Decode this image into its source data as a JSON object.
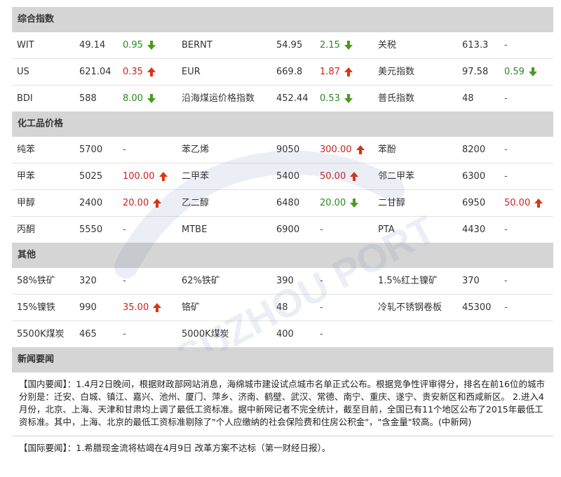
{
  "colors": {
    "up": "#cc2222",
    "down": "#2a8a1e",
    "header_bg": "#d5d5d5"
  },
  "watermark_text": "SUZHOU PORT",
  "sections": [
    {
      "title": "综合指数",
      "rows": [
        [
          {
            "name": "WIT",
            "value": "49.14",
            "change": "0.95",
            "dir": "down"
          },
          {
            "name": "BERNT",
            "value": "54.95",
            "change": "2.15",
            "dir": "down"
          },
          {
            "name": "关税",
            "value": "613.3",
            "change": "-",
            "dir": "flat"
          }
        ],
        [
          {
            "name": "US",
            "value": "621.04",
            "change": "0.35",
            "dir": "up"
          },
          {
            "name": "EUR",
            "value": "669.8",
            "change": "1.87",
            "dir": "up"
          },
          {
            "name": "美元指数",
            "value": "97.58",
            "change": "0.59",
            "dir": "down"
          }
        ],
        [
          {
            "name": "BDI",
            "value": "588",
            "change": "8.00",
            "dir": "down"
          },
          {
            "name": "沿海煤运价格指数",
            "value": "452.44",
            "change": "0.53",
            "dir": "down"
          },
          {
            "name": "普氏指数",
            "value": "48",
            "change": "-",
            "dir": "flat"
          }
        ]
      ]
    },
    {
      "title": "化工品价格",
      "rows": [
        [
          {
            "name": "纯苯",
            "value": "5700",
            "change": "-",
            "dir": "flat"
          },
          {
            "name": "苯乙烯",
            "value": "9050",
            "change": "300.00",
            "dir": "up"
          },
          {
            "name": "苯酚",
            "value": "8200",
            "change": "-",
            "dir": "flat"
          }
        ],
        [
          {
            "name": "甲苯",
            "value": "5025",
            "change": "100.00",
            "dir": "up"
          },
          {
            "name": "二甲苯",
            "value": "5400",
            "change": "50.00",
            "dir": "up"
          },
          {
            "name": "邻二甲苯",
            "value": "6300",
            "change": "-",
            "dir": "flat"
          }
        ],
        [
          {
            "name": "甲醇",
            "value": "2400",
            "change": "20.00",
            "dir": "up"
          },
          {
            "name": "乙二醇",
            "value": "6480",
            "change": "20.00",
            "dir": "down"
          },
          {
            "name": "二甘醇",
            "value": "6950",
            "change": "50.00",
            "dir": "up"
          }
        ],
        [
          {
            "name": "丙酮",
            "value": "5550",
            "change": "-",
            "dir": "flat"
          },
          {
            "name": "MTBE",
            "value": "6900",
            "change": "-",
            "dir": "flat"
          },
          {
            "name": "PTA",
            "value": "4430",
            "change": "-",
            "dir": "flat"
          }
        ]
      ]
    },
    {
      "title": "其他",
      "rows": [
        [
          {
            "name": "58%铁矿",
            "value": "320",
            "change": "-",
            "dir": "flat"
          },
          {
            "name": "62%铁矿",
            "value": "390",
            "change": "-",
            "dir": "flat"
          },
          {
            "name": "1.5%红土镍矿",
            "value": "370",
            "change": "-",
            "dir": "flat"
          }
        ],
        [
          {
            "name": "15%镍铁",
            "value": "990",
            "change": "35.00",
            "dir": "up"
          },
          {
            "name": "铬矿",
            "value": "48",
            "change": "-",
            "dir": "flat"
          },
          {
            "name": "冷轧不锈钢卷板",
            "value": "45300",
            "change": "-",
            "dir": "flat"
          }
        ],
        [
          {
            "name": "5500K煤炭",
            "value": "465",
            "change": "-",
            "dir": "flat"
          },
          {
            "name": "5000K煤炭",
            "value": "400",
            "change": "-",
            "dir": "flat"
          },
          {
            "name": "",
            "value": "",
            "change": "",
            "dir": "none"
          }
        ]
      ]
    }
  ],
  "news": {
    "title": "新闻要闻",
    "domestic_label": "【国内要闻】：",
    "domestic_text": "1.4月2日晚间，根据财政部网站消息，海绵城市建设试点城市名单正式公布。根据竞争性评审得分，排名在前16位的城市分别是：迁安、白城、镇江、嘉兴、池州、厦门、萍乡、济南、鹤壁、武汉、常德、南宁、重庆、遂宁、贵安新区和西咸新区。 2.进入4月份，北京、上海、天津和甘肃均上调了最低工资标准。据中新网记者不完全统计，截至目前，全国已有11个地区公布了2015年最低工资标准。其中，上海、北京的最低工资标准剔除了\"个人应缴纳的社会保险费和住房公积金\"，\"含金量\"较高。(中新网)",
    "intl_label": "【国际要闻】：",
    "intl_text": "1.希腊现金流将枯竭在4月9日 改革方案不达标（第一财经日报）。"
  }
}
